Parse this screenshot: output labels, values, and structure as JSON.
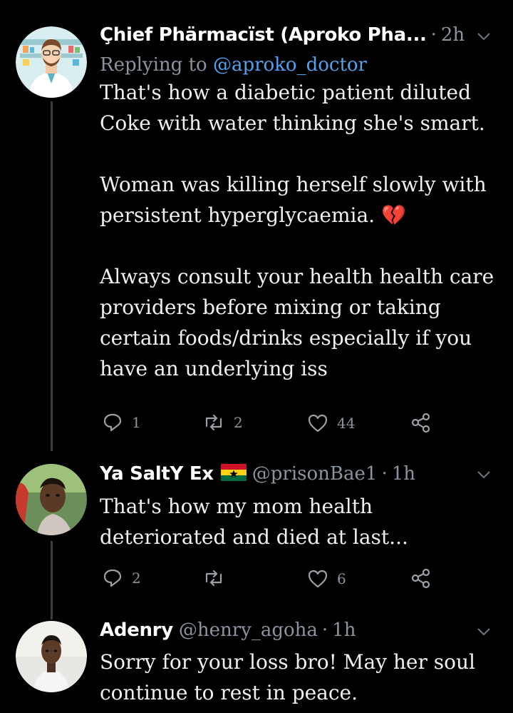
{
  "tweets": [
    {
      "name": "Çhief Phärmacïst (Aproko Pha...",
      "handle": "",
      "time": "2h",
      "replying_prefix": "Replying to ",
      "replying_mention": "@aproko_doctor",
      "text": "That's how a diabetic patient diluted Coke with water thinking she's smart.\n\nWoman was killing herself slowly with persistent hyperglycaemia. 💔\n\nAlways consult your health health care providers before mixing or taking certain foods/drinks especially if you have an underlying iss",
      "replies": "1",
      "retweets": "2",
      "likes": "44"
    },
    {
      "name": "Ya SaltY Ex",
      "handle": "@prisonBae1",
      "time": "1h",
      "text": "That's how my mom health deteriorated and died at last...",
      "replies": "2",
      "retweets": "",
      "likes": "6"
    },
    {
      "name": "Adenry",
      "handle": "@henry_agoha",
      "time": "1h",
      "text": "Sorry for your loss bro! May her soul continue to rest in peace."
    }
  ],
  "colors": {
    "background": "#000000",
    "muted": "#8b949e",
    "link": "#4fa3f0",
    "thread_line": "#3a3f44"
  },
  "icons": [
    "reply-icon",
    "retweet-icon",
    "like-icon",
    "share-icon",
    "chevron-down-icon",
    "broken-heart-icon",
    "ghana-flag-icon"
  ]
}
